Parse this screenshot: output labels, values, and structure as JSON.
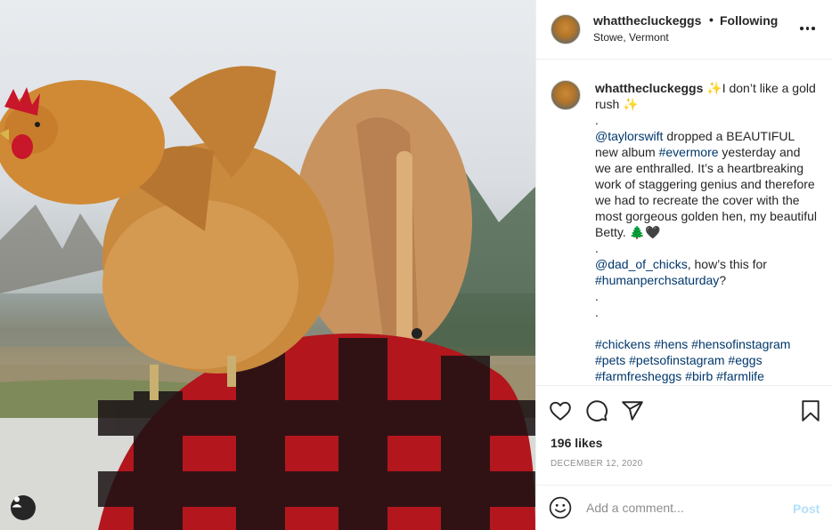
{
  "post": {
    "username": "whatthecluckeggs",
    "separator": "•",
    "follow_status": "Following",
    "location": "Stowe, Vermont"
  },
  "caption": {
    "username": "whatthecluckeggs",
    "line1": " ✨I don’t like a gold rush ✨",
    "dot1": ".",
    "mention1": "@taylorswift",
    "text1": " dropped a BEAUTIFUL new album ",
    "hashtag_evermore": "#evermore",
    "text2": " yesterday and we are enthralled. It’s a heartbreaking work of staggering genius and therefore we had to recreate the cover with the most gorgeous golden hen, my beautiful Betty. 🌲🖤",
    "dot2": ".",
    "mention2": "@dad_of_chicks",
    "text3": ", how’s this for ",
    "hashtag_perch": "#humanperchsaturday",
    "text4": "?",
    "dot3": ".",
    "dot4": ".",
    "hashtags_line1": "#chickens #hens #hensofinstagram",
    "hashtags_line2": "#pets #petsofinstagram #eggs",
    "hashtags_line3": "#farmfresheggs #birb #farmlife"
  },
  "actions": {
    "like_icon": "heart-icon",
    "comment_icon": "comment-icon",
    "share_icon": "share-icon",
    "save_icon": "bookmark-icon"
  },
  "likes": "196 likes",
  "date": "DECEMBER 12, 2020",
  "comment": {
    "placeholder": "Add a comment...",
    "post_label": "Post"
  },
  "colors": {
    "text": "#262626",
    "link": "#00376b",
    "muted": "#8e8e8e",
    "post_disabled": "#b2dffc",
    "border": "#efefef"
  }
}
